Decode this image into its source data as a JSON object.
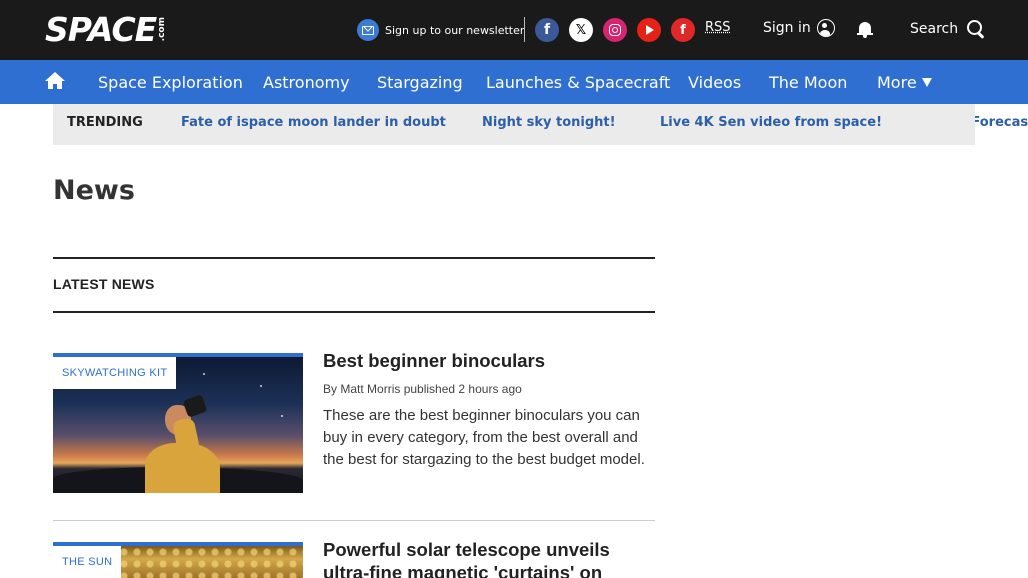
{
  "header": {
    "logo": "SPACE",
    "logo_suffix": ".com",
    "newsletter_label": "Sign up to our newsletter",
    "social": [
      {
        "name": "facebook-icon",
        "glyph": "f",
        "color": "#3b5998"
      },
      {
        "name": "x-icon",
        "glyph": "𝕏",
        "color": "#ffffff"
      },
      {
        "name": "instagram-icon",
        "glyph": "",
        "color": "#d6246e"
      },
      {
        "name": "youtube-icon",
        "glyph": "",
        "color": "#e62117"
      },
      {
        "name": "flipboard-icon",
        "glyph": "f",
        "color": "#e12828"
      }
    ],
    "rss_label": "RSS",
    "signin_label": "Sign in",
    "search_label": "Search"
  },
  "nav": {
    "items": [
      {
        "label": "Space Exploration"
      },
      {
        "label": "Astronomy"
      },
      {
        "label": "Stargazing"
      },
      {
        "label": "Launches & Spacecraft"
      },
      {
        "label": "Videos"
      },
      {
        "label": "The Moon"
      },
      {
        "label": "More"
      }
    ]
  },
  "trending": {
    "label": "TRENDING",
    "links": [
      {
        "label": "Fate of ispace moon lander in doubt"
      },
      {
        "label": "Night sky tonight!"
      },
      {
        "label": "Live 4K Sen video from space!"
      },
      {
        "label": "Aurora Forecast"
      }
    ]
  },
  "main": {
    "page_title": "News",
    "section_title": "LATEST NEWS",
    "articles": [
      {
        "category": "SKYWATCHING KIT",
        "headline": "Best beginner binoculars",
        "byline_prefix": "By",
        "author": "Matt Morris",
        "published": "published 2 hours ago",
        "synopsis": "These are the best beginner binoculars you can buy in every category, from the best overall and the best for stargazing to the best budget model."
      },
      {
        "category": "THE SUN",
        "headline": "Powerful solar telescope unveils ultra-fine magnetic 'curtains' on"
      }
    ]
  },
  "colors": {
    "topbar": "#1a1a1a",
    "nav": "#2e6fd1",
    "trending_bg": "#ebebeb",
    "link": "#2b5fa8"
  }
}
